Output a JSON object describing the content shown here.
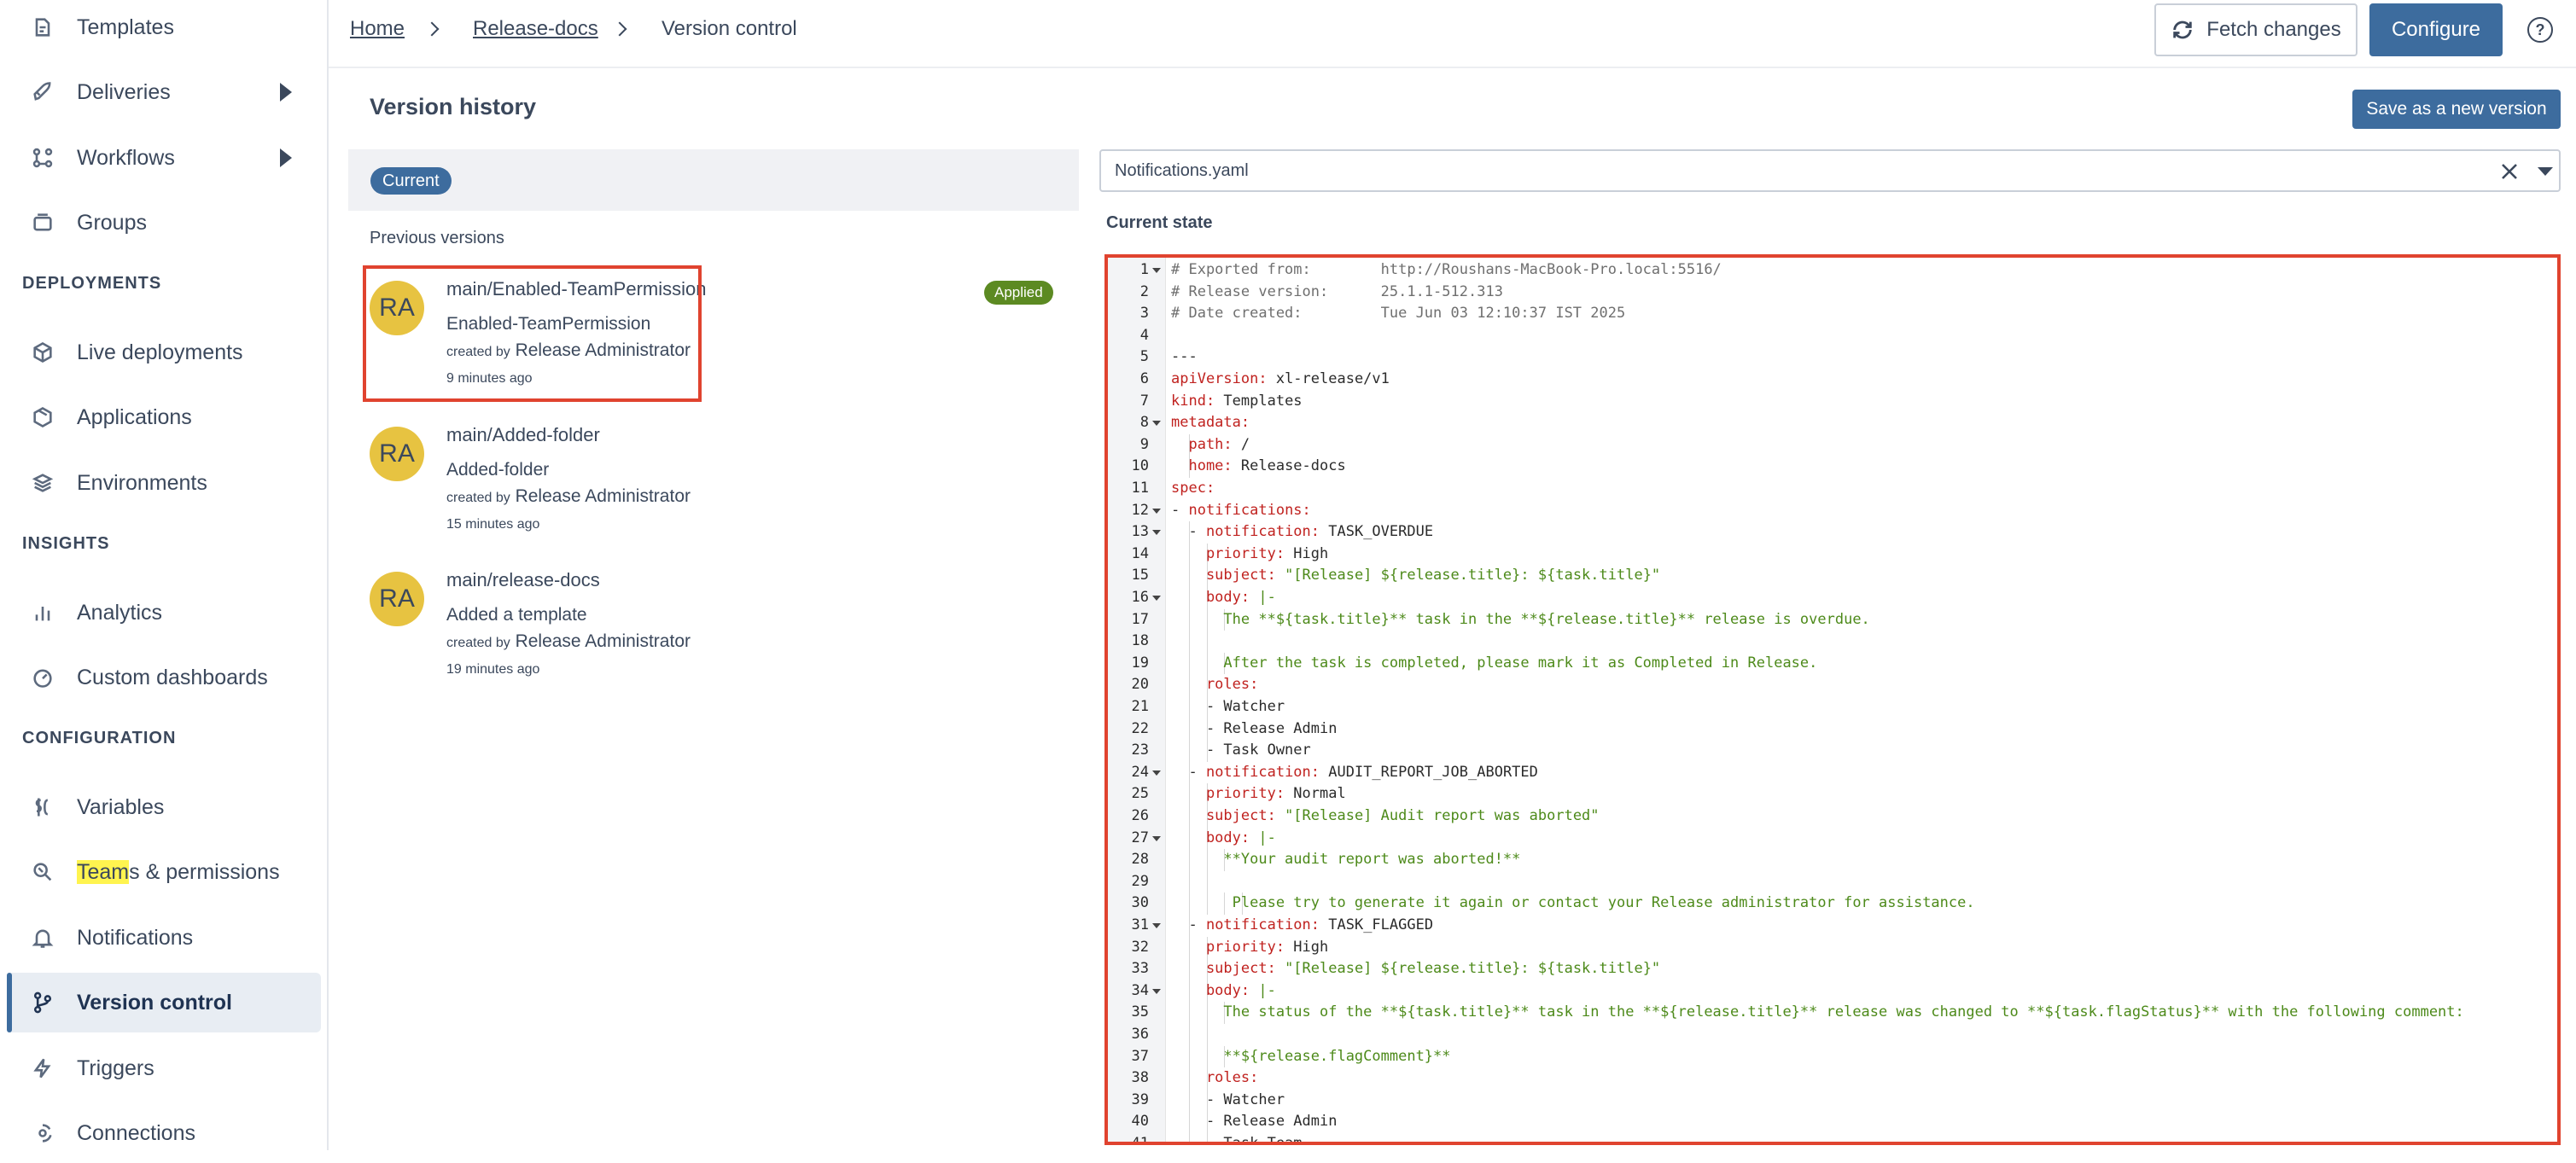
{
  "sidebar": {
    "items": [
      {
        "label": "Templates",
        "icon": "templates-icon"
      },
      {
        "label": "Deliveries",
        "icon": "rocket-icon"
      },
      {
        "label": "Workflows",
        "icon": "workflow-icon"
      },
      {
        "label": "Groups",
        "icon": "groups-icon"
      },
      {
        "label": "Live deployments",
        "icon": "cube-icon"
      },
      {
        "label": "Applications",
        "icon": "box-icon"
      },
      {
        "label": "Environments",
        "icon": "environments-icon"
      },
      {
        "label": "Analytics",
        "icon": "bar-chart-icon"
      },
      {
        "label": "Custom dashboards",
        "icon": "dashboard-icon"
      },
      {
        "label": "Variables",
        "icon": "variables-icon"
      },
      {
        "label_highlight": "Team",
        "label_rest": "s & permissions",
        "icon": "teams-icon"
      },
      {
        "label": "Notifications",
        "icon": "bell-icon"
      },
      {
        "label": "Version control",
        "icon": "branch-icon"
      },
      {
        "label": "Triggers",
        "icon": "lightning-icon"
      },
      {
        "label": "Connections",
        "icon": "connections-icon"
      }
    ],
    "sections": [
      "DEPLOYMENTS",
      "INSIGHTS",
      "CONFIGURATION"
    ]
  },
  "breadcrumb": {
    "home": "Home",
    "folder": "Release-docs",
    "current": "Version control"
  },
  "header": {
    "fetch_label": "Fetch changes",
    "configure_label": "Configure",
    "help_glyph": "?"
  },
  "history": {
    "title": "Version history",
    "save_label": "Save as a new version",
    "current_label": "Current",
    "previous_label": "Previous versions",
    "applied_label": "Applied",
    "created_by_prefix": "created by",
    "versions": [
      {
        "initials": "RA",
        "branch": "main/Enabled-TeamPermission",
        "message": "Enabled-TeamPermission",
        "author": "Release Administrator",
        "time": "9 minutes ago"
      },
      {
        "initials": "RA",
        "branch": "main/Added-folder",
        "message": "Added-folder",
        "author": "Release Administrator",
        "time": "15 minutes ago"
      },
      {
        "initials": "RA",
        "branch": "main/release-docs",
        "message": "Added a template",
        "author": "Release Administrator",
        "time": "19 minutes ago"
      }
    ]
  },
  "editor": {
    "file": "Notifications.yaml",
    "state_label": "Current state",
    "lines": [
      {
        "n": "1",
        "fold": true,
        "ind": 0,
        "parts": [
          [
            "c",
            "# Exported from:        http://Roushans-MacBook-Pro.local:5516/"
          ]
        ]
      },
      {
        "n": "2",
        "ind": 0,
        "parts": [
          [
            "c",
            "# Release version:      25.1.1-512.313"
          ]
        ]
      },
      {
        "n": "3",
        "ind": 0,
        "parts": [
          [
            "c",
            "# Date created:         Tue Jun 03 12:10:37 IST 2025"
          ]
        ]
      },
      {
        "n": "4",
        "ind": 0,
        "parts": []
      },
      {
        "n": "5",
        "ind": 0,
        "parts": [
          [
            "p",
            "---"
          ]
        ]
      },
      {
        "n": "6",
        "ind": 0,
        "parts": [
          [
            "k",
            "apiVersion:"
          ],
          [
            "p",
            " xl-release/v1"
          ]
        ]
      },
      {
        "n": "7",
        "ind": 0,
        "parts": [
          [
            "k",
            "kind:"
          ],
          [
            "p",
            " Templates"
          ]
        ]
      },
      {
        "n": "8",
        "fold": true,
        "ind": 0,
        "parts": [
          [
            "k",
            "metadata:"
          ]
        ]
      },
      {
        "n": "9",
        "ind": 1,
        "parts": [
          [
            "k",
            "  path:"
          ],
          [
            "p",
            " /"
          ]
        ]
      },
      {
        "n": "10",
        "ind": 1,
        "parts": [
          [
            "k",
            "  home:"
          ],
          [
            "p",
            " Release-docs"
          ]
        ]
      },
      {
        "n": "11",
        "ind": 0,
        "parts": [
          [
            "k",
            "spec:"
          ]
        ]
      },
      {
        "n": "12",
        "fold": true,
        "ind": 0,
        "parts": [
          [
            "p",
            "- "
          ],
          [
            "k",
            "notifications:"
          ]
        ]
      },
      {
        "n": "13",
        "fold": true,
        "ind": 1,
        "parts": [
          [
            "p",
            "  - "
          ],
          [
            "k",
            "notification:"
          ],
          [
            "p",
            " TASK_OVERDUE"
          ]
        ]
      },
      {
        "n": "14",
        "ind": 2,
        "parts": [
          [
            "k",
            "    priority:"
          ],
          [
            "p",
            " High"
          ]
        ]
      },
      {
        "n": "15",
        "ind": 2,
        "parts": [
          [
            "k",
            "    subject:"
          ],
          [
            "s",
            " \"[Release] ${release.title}: ${task.title}\""
          ]
        ]
      },
      {
        "n": "16",
        "fold": true,
        "ind": 2,
        "parts": [
          [
            "k",
            "    body:"
          ],
          [
            "s",
            " |-"
          ]
        ]
      },
      {
        "n": "17",
        "ind": 3,
        "parts": [
          [
            "s",
            "      The **${task.title}** task in the **${release.title}** release is overdue."
          ]
        ]
      },
      {
        "n": "18",
        "ind": 2,
        "parts": []
      },
      {
        "n": "19",
        "ind": 3,
        "parts": [
          [
            "s",
            "      After the task is completed, please mark it as Completed in Release."
          ]
        ]
      },
      {
        "n": "20",
        "ind": 2,
        "parts": [
          [
            "k",
            "    roles:"
          ]
        ]
      },
      {
        "n": "21",
        "ind": 2,
        "parts": [
          [
            "p",
            "    - Watcher"
          ]
        ]
      },
      {
        "n": "22",
        "ind": 2,
        "parts": [
          [
            "p",
            "    - Release Admin"
          ]
        ]
      },
      {
        "n": "23",
        "ind": 2,
        "parts": [
          [
            "p",
            "    - Task Owner"
          ]
        ]
      },
      {
        "n": "24",
        "fold": true,
        "ind": 1,
        "parts": [
          [
            "p",
            "  - "
          ],
          [
            "k",
            "notification:"
          ],
          [
            "p",
            " AUDIT_REPORT_JOB_ABORTED"
          ]
        ]
      },
      {
        "n": "25",
        "ind": 2,
        "parts": [
          [
            "k",
            "    priority:"
          ],
          [
            "p",
            " Normal"
          ]
        ]
      },
      {
        "n": "26",
        "ind": 2,
        "parts": [
          [
            "k",
            "    subject:"
          ],
          [
            "s",
            " \"[Release] Audit report was aborted\""
          ]
        ]
      },
      {
        "n": "27",
        "fold": true,
        "ind": 2,
        "parts": [
          [
            "k",
            "    body:"
          ],
          [
            "s",
            " |-"
          ]
        ]
      },
      {
        "n": "28",
        "ind": 3,
        "parts": [
          [
            "s",
            "      **Your audit report was aborted!**"
          ]
        ]
      },
      {
        "n": "29",
        "ind": 2,
        "parts": []
      },
      {
        "n": "30",
        "ind": 4,
        "parts": [
          [
            "s",
            "       Please try to generate it again or contact your Release administrator for assistance."
          ]
        ]
      },
      {
        "n": "31",
        "fold": true,
        "ind": 1,
        "parts": [
          [
            "p",
            "  - "
          ],
          [
            "k",
            "notification:"
          ],
          [
            "p",
            " TASK_FLAGGED"
          ]
        ]
      },
      {
        "n": "32",
        "ind": 2,
        "parts": [
          [
            "k",
            "    priority:"
          ],
          [
            "p",
            " High"
          ]
        ]
      },
      {
        "n": "33",
        "ind": 2,
        "parts": [
          [
            "k",
            "    subject:"
          ],
          [
            "s",
            " \"[Release] ${release.title}: ${task.title}\""
          ]
        ]
      },
      {
        "n": "34",
        "fold": true,
        "ind": 2,
        "parts": [
          [
            "k",
            "    body:"
          ],
          [
            "s",
            " |-"
          ]
        ]
      },
      {
        "n": "35",
        "ind": 3,
        "parts": [
          [
            "s",
            "      The status of the **${task.title}** task in the **${release.title}** release was changed to **${task.flagStatus}** with the following comment:"
          ]
        ]
      },
      {
        "n": "36",
        "ind": 2,
        "parts": []
      },
      {
        "n": "37",
        "ind": 3,
        "parts": [
          [
            "s",
            "      **${release.flagComment}**"
          ]
        ]
      },
      {
        "n": "38",
        "ind": 2,
        "parts": [
          [
            "k",
            "    roles:"
          ]
        ]
      },
      {
        "n": "39",
        "ind": 2,
        "parts": [
          [
            "p",
            "    - Watcher"
          ]
        ]
      },
      {
        "n": "40",
        "ind": 2,
        "parts": [
          [
            "p",
            "    - Release Admin"
          ]
        ]
      },
      {
        "n": "41",
        "ind": 2,
        "parts": [
          [
            "p",
            "    - Task Team"
          ]
        ]
      }
    ]
  },
  "colors": {
    "accent": "#3d6c9e",
    "applied": "#5c8a22",
    "avatar": "#e7c341",
    "highlight_box": "#e0432f",
    "yaml_key": "#c0221f",
    "yaml_string": "#4d8a1a"
  }
}
